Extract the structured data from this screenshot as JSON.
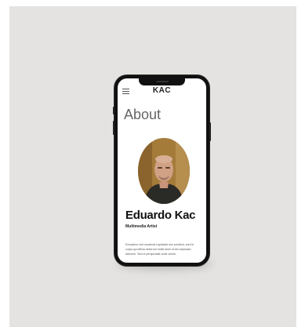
{
  "header": {
    "brand": "KAC",
    "menu_icon": "hamburger-menu-icon"
  },
  "page": {
    "title": "About"
  },
  "profile": {
    "name": "Eduardo Kac",
    "role": "Multimedia Artist",
    "bio": "Excepteur sint occaecat cupidatat non proident, sunt in culpa qui officia deserunt mollit anim id est explicabo laborum. Sed ut perspiciatis unde omnis."
  },
  "colors": {
    "backdrop": "#e4e3e1",
    "phone_frame": "#111111",
    "screen": "#ffffff",
    "title_text": "#666666",
    "name_text": "#111111"
  }
}
